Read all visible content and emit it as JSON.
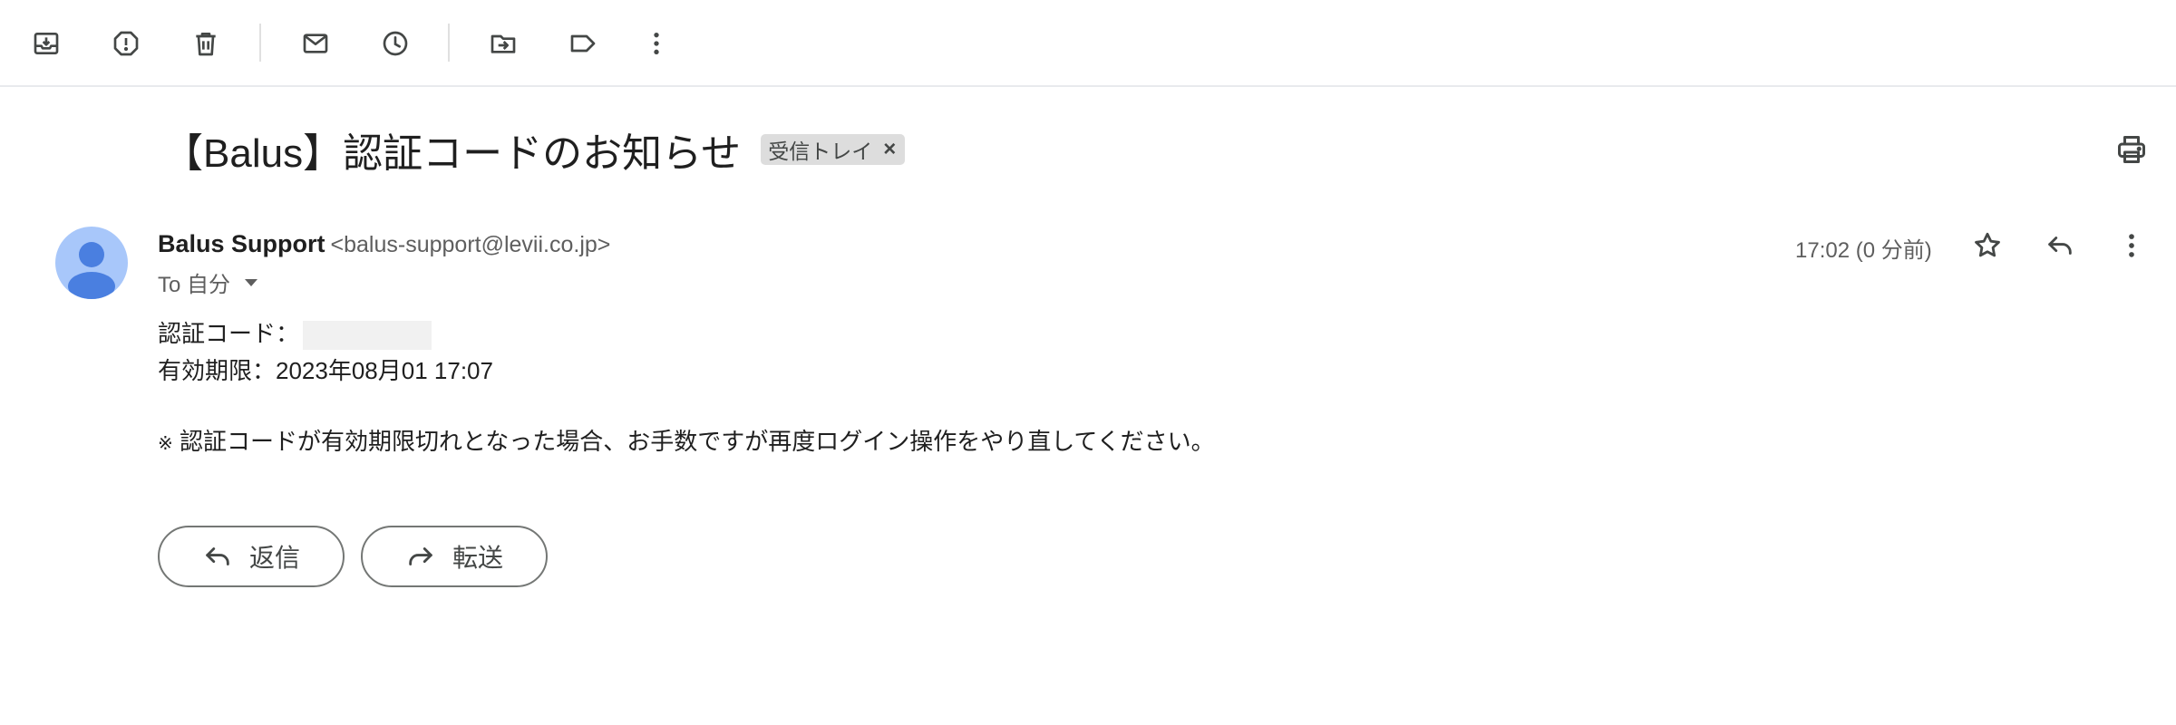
{
  "toolbar": {
    "icons": [
      "archive-icon",
      "report-spam-icon",
      "delete-icon",
      "mark-unread-icon",
      "snooze-icon",
      "move-to-icon",
      "label-icon",
      "more-vert-icon"
    ]
  },
  "message": {
    "subject": "【Balus】認証コードのお知らせ",
    "label_chip": "受信トレイ",
    "label_close": "×",
    "sender_name": "Balus Support",
    "sender_email": "<balus-support@levii.co.jp>",
    "to_line": "To 自分",
    "timestamp": "17:02 (0 分前)"
  },
  "body": {
    "code_label": "認証コード：",
    "expiry": "有効期限：2023年08月01 17:07",
    "note_mark": "※",
    "note_text": " 認証コードが有効期限切れとなった場合、お手数ですが再度ログイン操作をやり直してください。"
  },
  "actions": {
    "reply_label": "返信",
    "forward_label": "転送"
  },
  "colors": {
    "avatar_bg": "#a8c7fa",
    "avatar_fg": "#4a7fe0",
    "chip_bg": "#dddddd",
    "icon": "#444746"
  }
}
